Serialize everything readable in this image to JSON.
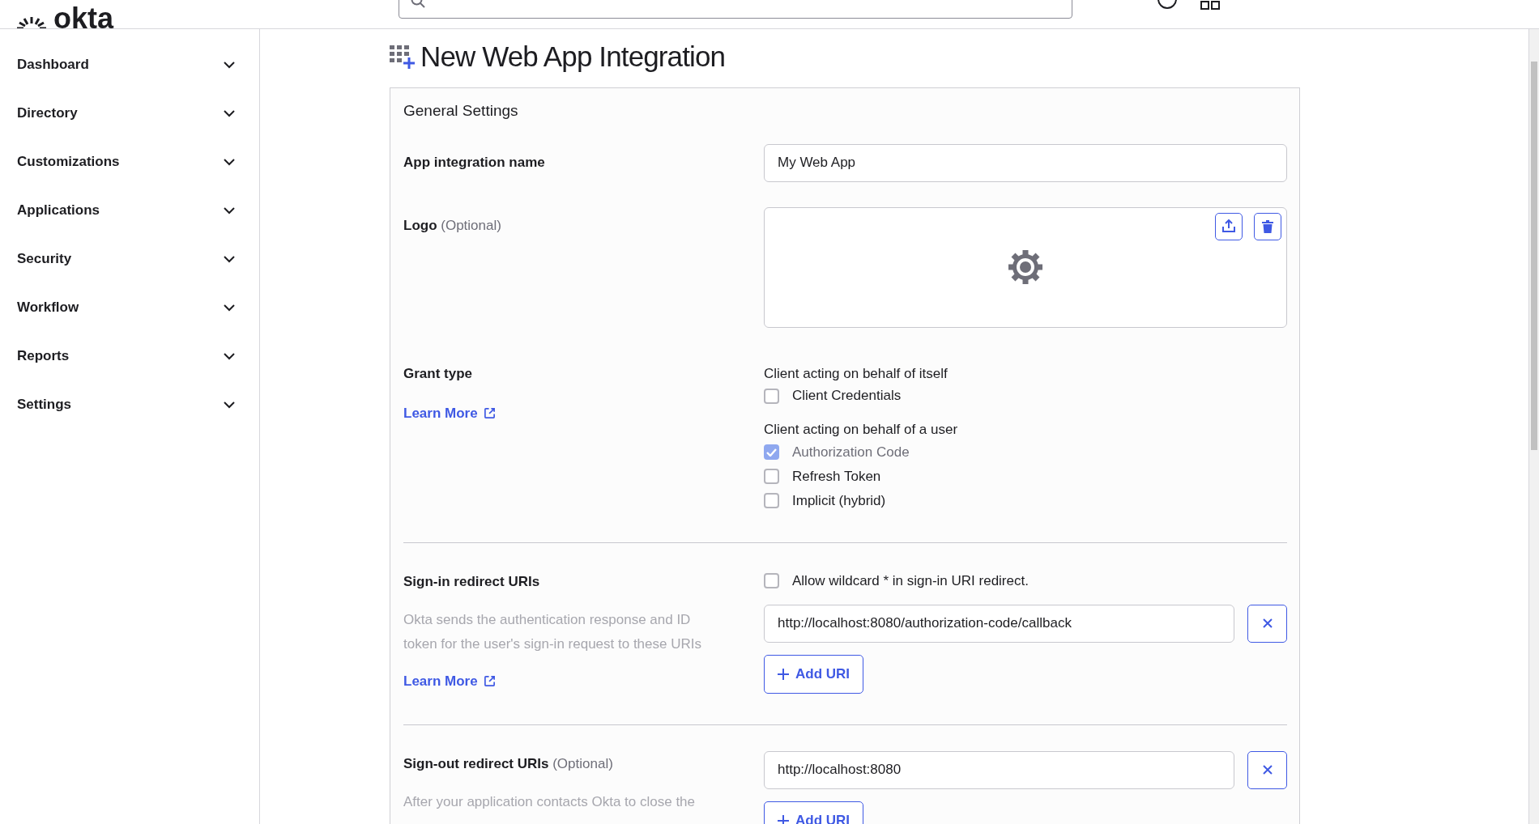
{
  "top_bar": {
    "logo": "okta"
  },
  "sidebar": {
    "items": [
      {
        "label": "Dashboard",
        "expanded": false
      },
      {
        "label": "Directory",
        "expanded": false
      },
      {
        "label": "Customizations",
        "expanded": false
      },
      {
        "label": "Applications",
        "expanded": false
      },
      {
        "label": "Security",
        "expanded": false
      },
      {
        "label": "Workflow",
        "expanded": false
      },
      {
        "label": "Reports",
        "expanded": false
      },
      {
        "label": "Settings",
        "expanded": false
      }
    ]
  },
  "page": {
    "title": "New Web App Integration"
  },
  "general_settings": {
    "title": "General Settings",
    "fields": [
      {
        "kind": "text",
        "label": "App integration name",
        "value": "My Web App"
      },
      {
        "kind": "logo",
        "label": "Logo",
        "optional": "(Optional)"
      },
      {
        "kind": "grant",
        "label": "Grant type",
        "link": "Learn More",
        "groups": [
          {
            "heading": "Client acting on behalf of itself",
            "options": [
              {
                "label": "Client Credentials",
                "checked": false,
                "disabled": false
              }
            ]
          },
          {
            "heading": "Client acting on behalf of a user",
            "options": [
              {
                "label": "Authorization Code",
                "checked": true,
                "disabled": true
              },
              {
                "label": "Refresh Token",
                "checked": false,
                "disabled": false
              },
              {
                "label": "Implicit (hybrid)",
                "checked": false,
                "disabled": false
              }
            ]
          }
        ]
      },
      {
        "kind": "uris",
        "label": "Sign-in redirect URIs",
        "description": "Okta sends the authentication response and ID token for the user's sign-in request to these URIs",
        "link": "Learn More",
        "wildcard": {
          "label": "Allow wildcard * in sign-in URI redirect.",
          "checked": false
        },
        "uris": [
          "http://localhost:8080/authorization-code/callback"
        ],
        "add_button": "Add URI"
      },
      {
        "kind": "uris",
        "label": "Sign-out redirect URIs",
        "optional": "(Optional)",
        "description": "After your application contacts Okta to close the",
        "uris": [
          "http://localhost:8080"
        ],
        "add_button": "Add URI"
      }
    ]
  }
}
